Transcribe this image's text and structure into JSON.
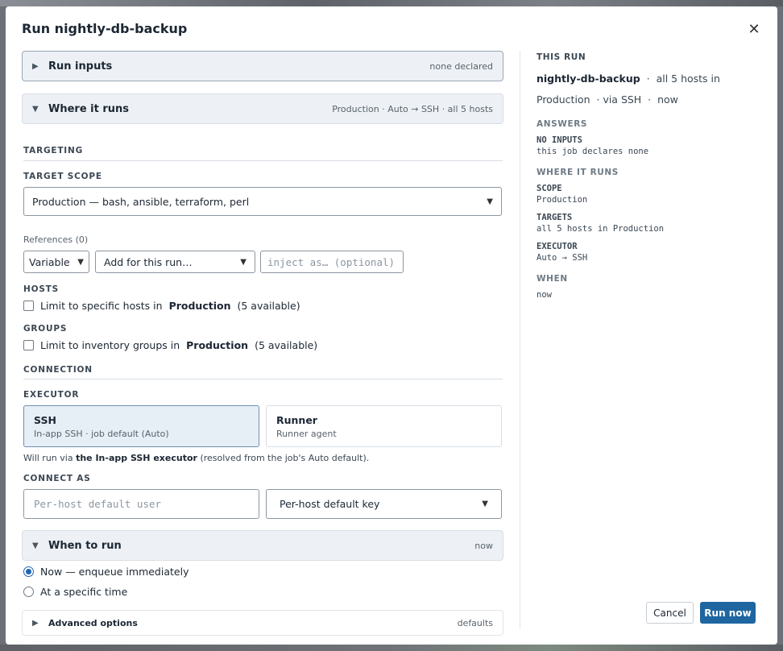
{
  "modal": {
    "title": "Run nightly-db-backup",
    "close_glyph": "✕"
  },
  "sections": {
    "run_inputs": {
      "caret": "▶",
      "title": "Run inputs",
      "meta": "none declared"
    },
    "where_it_runs": {
      "caret": "▼",
      "title": "Where it runs",
      "meta": "Production · Auto → SSH · all 5 hosts"
    },
    "when_to_run": {
      "caret": "▼",
      "title": "When to run",
      "meta": "now"
    },
    "advanced": {
      "caret": "▶",
      "title": "Advanced options",
      "meta": "defaults"
    }
  },
  "targeting": {
    "heading": "TARGETING",
    "scope_label": "TARGET SCOPE",
    "scope_value": "Production — bash, ansible, terraform, perl",
    "references_label": "References (0)",
    "ref_type": "Variable",
    "ref_action": "Add for this run…",
    "inject_placeholder": "inject as… (optional)",
    "hosts_label": "HOSTS",
    "hosts_check_prefix": "Limit to specific hosts in",
    "hosts_check_env": "Production",
    "hosts_check_suffix": "(5 available)",
    "groups_label": "GROUPS",
    "groups_check_prefix": "Limit to inventory groups in",
    "groups_check_env": "Production",
    "groups_check_suffix": "(5 available)"
  },
  "connection": {
    "heading": "CONNECTION",
    "executor_label": "EXECUTOR",
    "executors": [
      {
        "title": "SSH",
        "subtitle": "In-app SSH · job default (Auto)",
        "selected": true
      },
      {
        "title": "Runner",
        "subtitle": "Runner agent",
        "selected": false
      }
    ],
    "note_prefix": "Will run via",
    "note_bold": "the In-app SSH executor",
    "note_suffix": "(resolved from the job's Auto default).",
    "connect_as_label": "CONNECT AS",
    "user_placeholder": "Per-host default user",
    "key_value": "Per-host default key"
  },
  "when": {
    "options": [
      {
        "label": "Now — enqueue immediately",
        "selected": true
      },
      {
        "label": "At a specific time",
        "selected": false
      }
    ]
  },
  "summary": {
    "heading": "THIS RUN",
    "job": "nightly-db-backup",
    "sep": "·",
    "targets_text": "all 5 hosts in Production",
    "via_text": "via SSH",
    "when_text": "now",
    "answers_heading": "ANSWERS",
    "no_inputs_key": "NO INPUTS",
    "no_inputs_val": "this job declares none",
    "where_heading": "WHERE IT RUNS",
    "scope_key": "SCOPE",
    "scope_val": "Production",
    "targets_key": "TARGETS",
    "targets_val": "all 5 hosts in Production",
    "executor_key": "EXECUTOR",
    "executor_val": "Auto → SSH",
    "when_heading": "WHEN",
    "when_val": "now"
  },
  "footer": {
    "cancel": "Cancel",
    "run": "Run now"
  },
  "colors": {
    "primary": "#1f66a0",
    "selected_card": "#e6eef6",
    "section_bg": "#edf1f5"
  }
}
